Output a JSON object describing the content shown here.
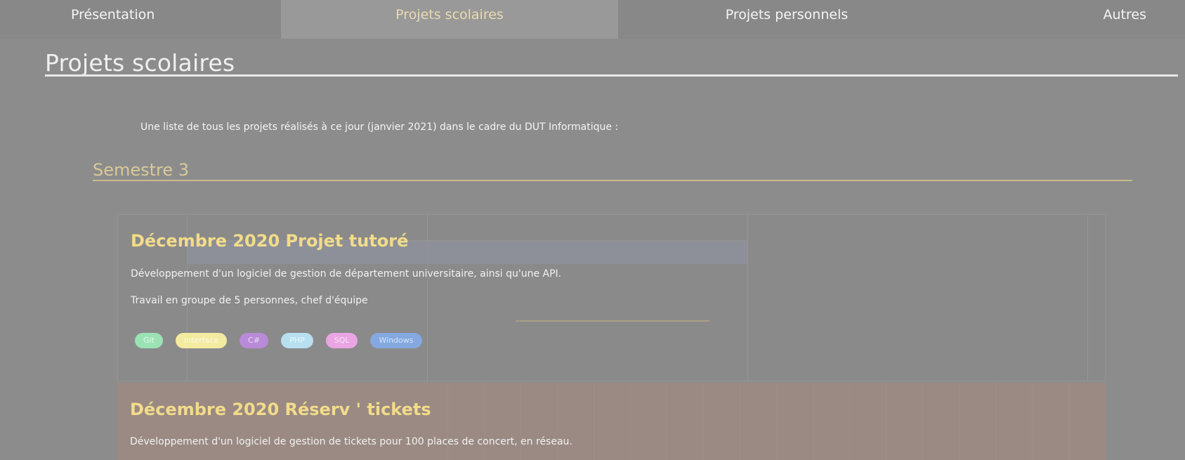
{
  "nav": {
    "presentation": "Présentation",
    "projets_scolaires": "Projets scolaires",
    "projets_personnels": "Projets personnels",
    "autres": "Autres"
  },
  "page": {
    "title": "Projets scolaires",
    "intro": "Une liste de tous les projets réalisés à ce jour (janvier 2021) dans le cadre du DUT Informatique :"
  },
  "semester": {
    "title": "Semestre 3"
  },
  "projects": [
    {
      "title": "Décembre 2020 Projet tutoré",
      "description": "Développement d'un logiciel de gestion de département universitaire, ainsi qu'une API.",
      "details": "Travail en groupe de 5 personnes, chef d'équipe",
      "tags": [
        {
          "label": "Git",
          "color": "#9be3b4"
        },
        {
          "label": "Interface",
          "color": "#f3eba0"
        },
        {
          "label": "C#",
          "color": "#b98ad8"
        },
        {
          "label": "PHP",
          "color": "#b7dff0"
        },
        {
          "label": "SQL",
          "color": "#e9a6e3"
        },
        {
          "label": "Windows",
          "color": "#84a8df"
        }
      ]
    },
    {
      "title": "Décembre 2020 Réserv ' tickets",
      "description": "Développement d'un logiciel de gestion de tickets pour 100 places de concert, en réseau."
    }
  ]
}
